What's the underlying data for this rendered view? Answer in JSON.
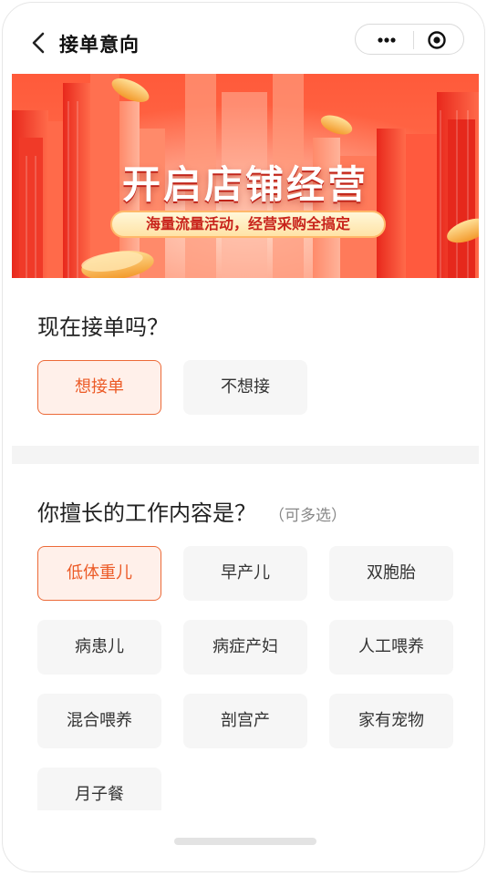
{
  "header": {
    "title": "接单意向"
  },
  "banner": {
    "title": "开启店铺经营",
    "subtitle": "海量流量活动，经营采购全搞定",
    "colors": {
      "primary": "#f0382a",
      "light": "#ff8a6a"
    }
  },
  "question1": {
    "label": "现在接单吗？",
    "options": [
      {
        "label": "想接单",
        "selected": true
      },
      {
        "label": "不想接",
        "selected": false
      }
    ]
  },
  "question2": {
    "label": "你擅长的工作内容是？",
    "hint": "（可多选）",
    "options": [
      {
        "label": "低体重儿",
        "selected": true
      },
      {
        "label": "早产儿",
        "selected": false
      },
      {
        "label": "双胞胎",
        "selected": false
      },
      {
        "label": "病患儿",
        "selected": false
      },
      {
        "label": "病症产妇",
        "selected": false
      },
      {
        "label": "人工喂养",
        "selected": false
      },
      {
        "label": "混合喂养",
        "selected": false
      },
      {
        "label": "剖宫产",
        "selected": false
      },
      {
        "label": "家有宠物",
        "selected": false
      },
      {
        "label": "月子餐",
        "selected": false
      }
    ]
  },
  "theme": {
    "accent": "#ec5a26",
    "accent_bg": "#fff0ea",
    "option_bg": "#f6f6f6"
  },
  "icons": [
    "back-chevron-icon",
    "more-dots-icon",
    "target-icon"
  ]
}
